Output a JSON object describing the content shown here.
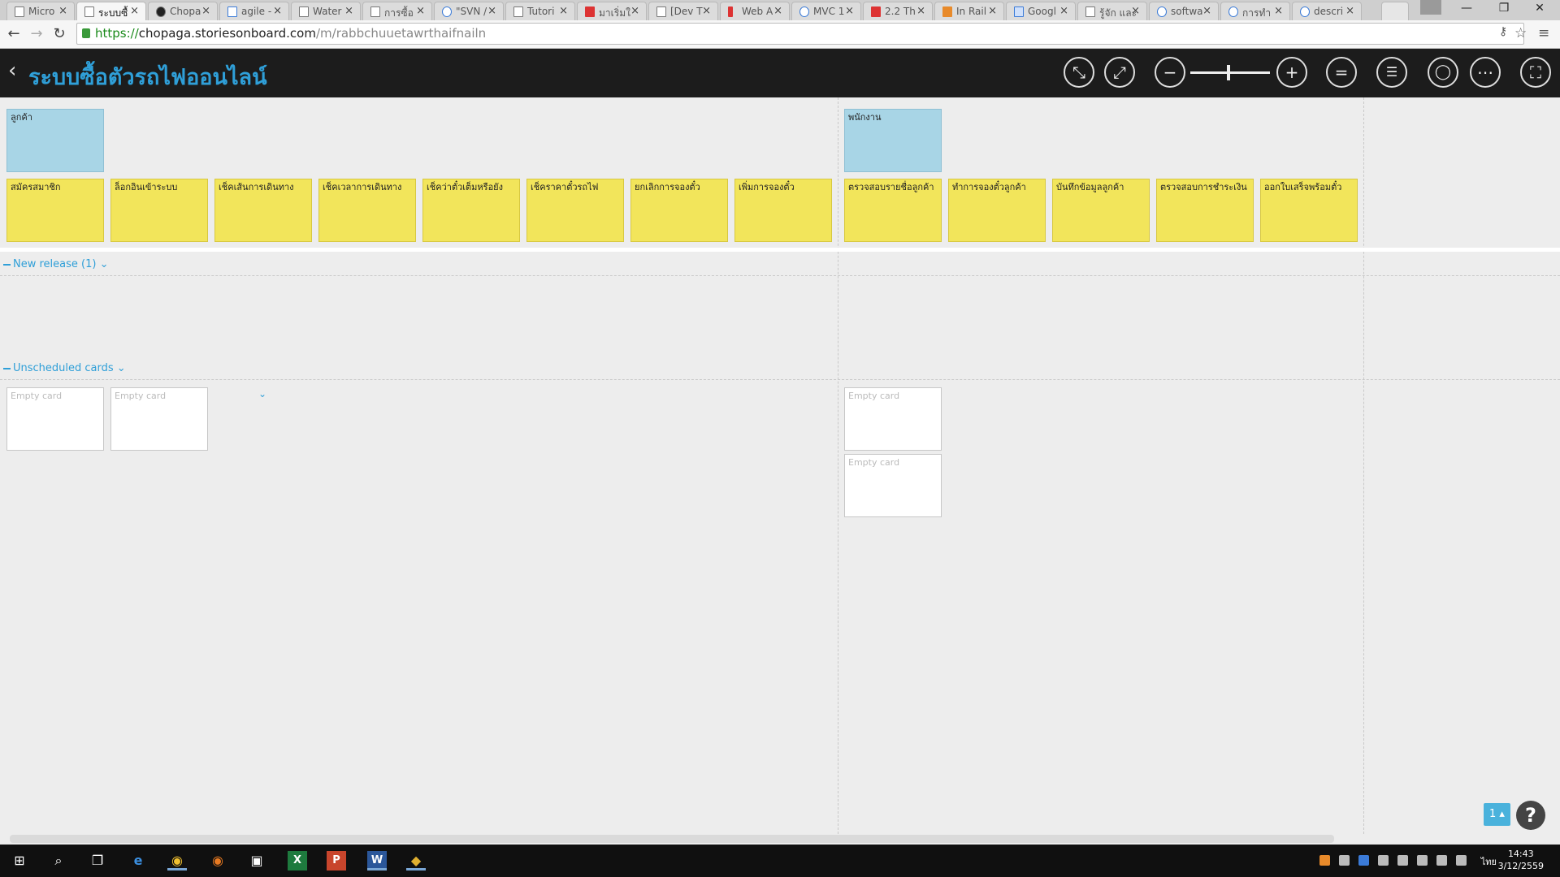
{
  "browser": {
    "tabs": [
      {
        "label": "Micro"
      },
      {
        "label": "ระบบซื้"
      },
      {
        "label": "Chopa"
      },
      {
        "label": "agile -"
      },
      {
        "label": "Water"
      },
      {
        "label": "การซื้อ"
      },
      {
        "label": "\"SVN /"
      },
      {
        "label": "Tutori"
      },
      {
        "label": "มาเริ่มใ"
      },
      {
        "label": "[Dev T"
      },
      {
        "label": "Web A"
      },
      {
        "label": "MVC 1"
      },
      {
        "label": "2.2 Th"
      },
      {
        "label": "In Rail"
      },
      {
        "label": "Googl"
      },
      {
        "label": "รู้จัก และ"
      },
      {
        "label": "softwa"
      },
      {
        "label": "การทำ"
      },
      {
        "label": "descri"
      }
    ],
    "url_scheme": "https://",
    "url_host": "chopaga.storiesonboard.com",
    "url_path": "/m/rabbchuuetawrthaifnailn"
  },
  "header": {
    "title": "ระบบซื้อตัวรถไฟออนไลน์"
  },
  "board": {
    "personas": [
      {
        "label": "ลูกค้า"
      },
      {
        "label": "พนักงาน"
      }
    ],
    "activities_customer": [
      "สมัครสมาชิก",
      "ล็อกอินเข้าระบบ",
      "เช็คเส้นการเดินทาง",
      "เช็คเวลาการเดินทาง",
      "เช็คว่าตั๋วเต็มหรือยัง",
      "เช็คราคาตั๋วรถไฟ",
      "ยกเลิกการจองตั๋ว",
      "เพิ่มการจองตั๋ว"
    ],
    "activities_staff": [
      "ตรวจสอบรายชื่อลูกค้า",
      "ทำการจองตั๋วลูกค้า",
      "บันทึกข้อมูลลูกค้า",
      "ตรวจสอบการชำระเงิน",
      "ออกใบเสร็จพร้อมตั๋ว"
    ],
    "release_label": "New release (1)",
    "unscheduled_label": "Unscheduled cards",
    "empty_card": "Empty card"
  },
  "overlay": {
    "users_count": "1",
    "help_symbol": "?"
  },
  "taskbar": {
    "time": "14:43",
    "date": "3/12/2559",
    "lang": "ไทย"
  }
}
